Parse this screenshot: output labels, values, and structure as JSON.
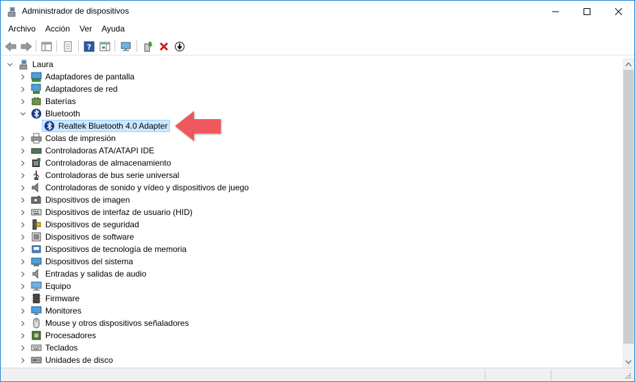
{
  "window": {
    "title": "Administrador de dispositivos",
    "controls": {
      "minimize": "minimize-icon",
      "maximize": "maximize-icon",
      "close": "close-icon"
    }
  },
  "menu": [
    "Archivo",
    "Acción",
    "Ver",
    "Ayuda"
  ],
  "toolbar": {
    "buttons": [
      "back-icon",
      "forward-icon",
      "show-hide-console-tree-icon",
      "properties-icon",
      "help-icon",
      "show-action-pane-icon",
      "scan-hardware-changes-icon",
      "update-driver-icon",
      "uninstall-device-icon",
      "disable-device-icon"
    ]
  },
  "tree": {
    "root": "Laura",
    "categories": [
      {
        "label": "Adaptadores de pantalla",
        "icon": "display-adapter-icon",
        "expanded": false
      },
      {
        "label": "Adaptadores de red",
        "icon": "network-adapter-icon",
        "expanded": false
      },
      {
        "label": "Baterías",
        "icon": "battery-icon",
        "expanded": false
      },
      {
        "label": "Bluetooth",
        "icon": "bluetooth-icon",
        "expanded": true,
        "children": [
          {
            "label": "Realtek Bluetooth 4.0 Adapter",
            "icon": "bluetooth-icon",
            "selected": true
          }
        ]
      },
      {
        "label": "Colas de impresión",
        "icon": "printer-icon",
        "expanded": false
      },
      {
        "label": "Controladoras ATA/ATAPI IDE",
        "icon": "ide-controller-icon",
        "expanded": false
      },
      {
        "label": "Controladoras de almacenamiento",
        "icon": "storage-controller-icon",
        "expanded": false
      },
      {
        "label": "Controladoras de bus serie universal",
        "icon": "usb-icon",
        "expanded": false
      },
      {
        "label": "Controladoras de sonido y vídeo y dispositivos de juego",
        "icon": "speaker-icon",
        "expanded": false
      },
      {
        "label": "Dispositivos de imagen",
        "icon": "camera-icon",
        "expanded": false
      },
      {
        "label": "Dispositivos de interfaz de usuario (HID)",
        "icon": "hid-icon",
        "expanded": false
      },
      {
        "label": "Dispositivos de seguridad",
        "icon": "security-device-icon",
        "expanded": false
      },
      {
        "label": "Dispositivos de software",
        "icon": "software-device-icon",
        "expanded": false
      },
      {
        "label": "Dispositivos de tecnología de memoria",
        "icon": "memory-device-icon",
        "expanded": false
      },
      {
        "label": "Dispositivos del sistema",
        "icon": "system-device-icon",
        "expanded": false
      },
      {
        "label": "Entradas y salidas de audio",
        "icon": "audio-io-icon",
        "expanded": false
      },
      {
        "label": "Equipo",
        "icon": "computer-icon",
        "expanded": false
      },
      {
        "label": "Firmware",
        "icon": "firmware-icon",
        "expanded": false
      },
      {
        "label": "Monitores",
        "icon": "monitor-icon",
        "expanded": false
      },
      {
        "label": "Mouse y otros dispositivos señaladores",
        "icon": "mouse-icon",
        "expanded": false
      },
      {
        "label": "Procesadores",
        "icon": "processor-icon",
        "expanded": false
      },
      {
        "label": "Teclados",
        "icon": "keyboard-icon",
        "expanded": false
      },
      {
        "label": "Unidades de disco",
        "icon": "disk-drive-icon",
        "expanded": false
      }
    ]
  },
  "colors": {
    "accent": "#1883d7",
    "selection": "#cce8ff",
    "pointer": "#f0595e"
  }
}
